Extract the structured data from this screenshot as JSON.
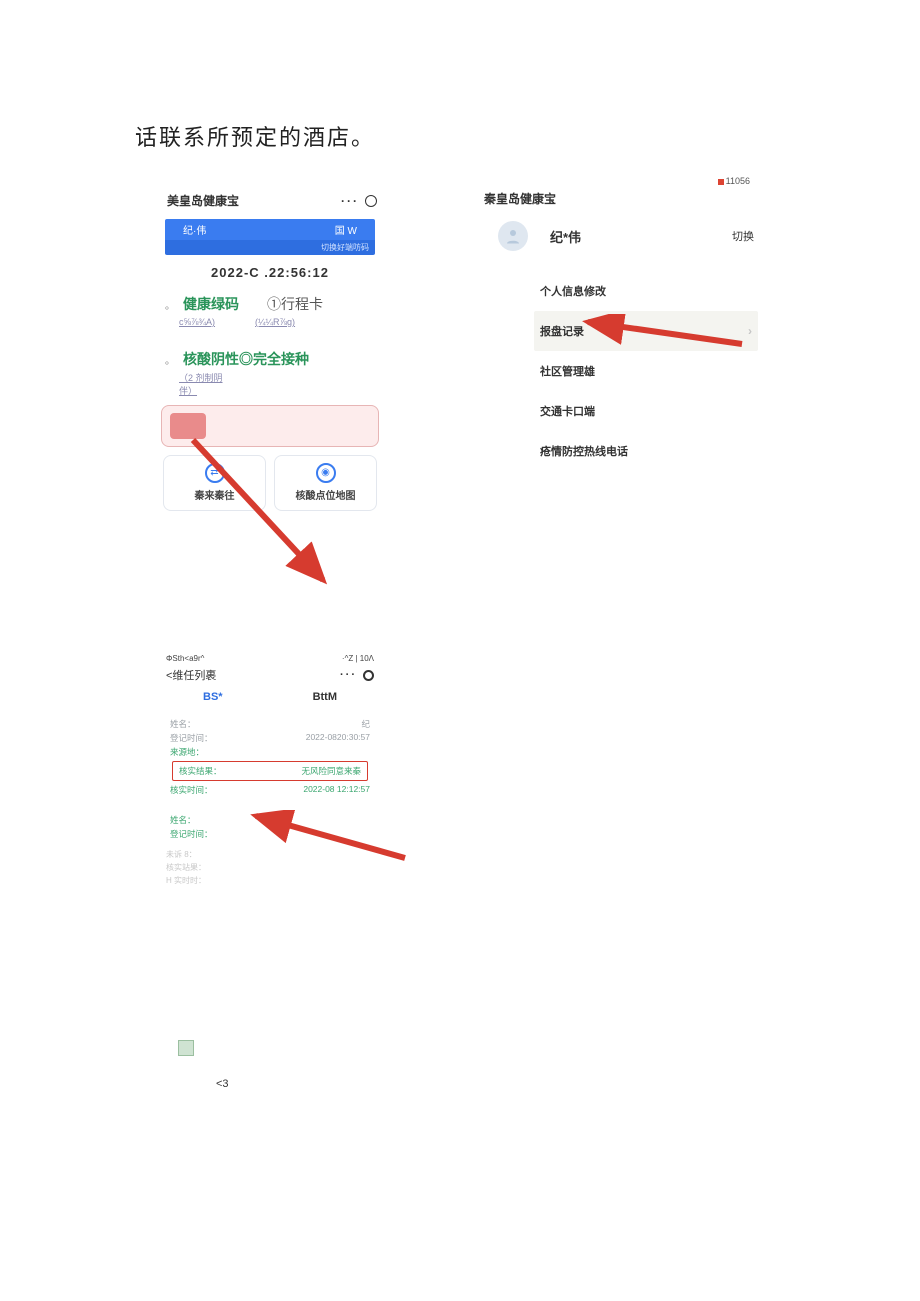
{
  "page": {
    "title_line": "话联系所预定的酒店。"
  },
  "phone1": {
    "header_title": "美皇岛健康宝",
    "blue_left": "纪·伟",
    "blue_right": "国 W",
    "blue_sub": "切换好端㕫码",
    "timestamp": "2022-C   .22:56:12",
    "green_code_label": "健康绿码",
    "trip_card_label": "①行程卡",
    "sublink_left": "c⅝⅞¾A)",
    "sublink_right": "(¼¼R⅞g)",
    "nucleic_label": "核酸阴性◎完全接种",
    "nucleic_sub": "（2 剂制阴\n伴）",
    "card1_label": "秦来秦往",
    "card2_label": "核酸点位地图"
  },
  "phone2": {
    "top_code": "11056",
    "header_title": "秦皇岛健康宝",
    "user_name": "纪*伟",
    "switch_label": "切换",
    "menu": {
      "item1": "个人信息修改",
      "item2": "报盘记录",
      "item3": "社区管理雄",
      "item4": "交通卡口端",
      "item5": "疮情防控热线电话"
    }
  },
  "phone3": {
    "status_left": "ΦSth<a9r^",
    "status_right": "·^Z | 10Λ",
    "back_label": "<维任列裹",
    "tab_active": "BS*",
    "tab_other": "BttM",
    "rec1": {
      "name_label": "姓名：",
      "name_val": "纪",
      "time_label": "登记时间：",
      "time_val": "2022-0820:30:57",
      "src_label": "来源地：",
      "src_val": "",
      "result_label": "核实结果：",
      "result_val": "无风险同意来秦",
      "rtime_label": "核实时间：",
      "rtime_val": "2022-08    12:12:57"
    },
    "rec2": {
      "name_label": "姓名：",
      "time_label": "登记时间：",
      "faint1": "未诉 8：",
      "faint2": "核实站果：",
      "faint3": "H 实时时："
    }
  },
  "footer": {
    "lt3": "<3"
  }
}
